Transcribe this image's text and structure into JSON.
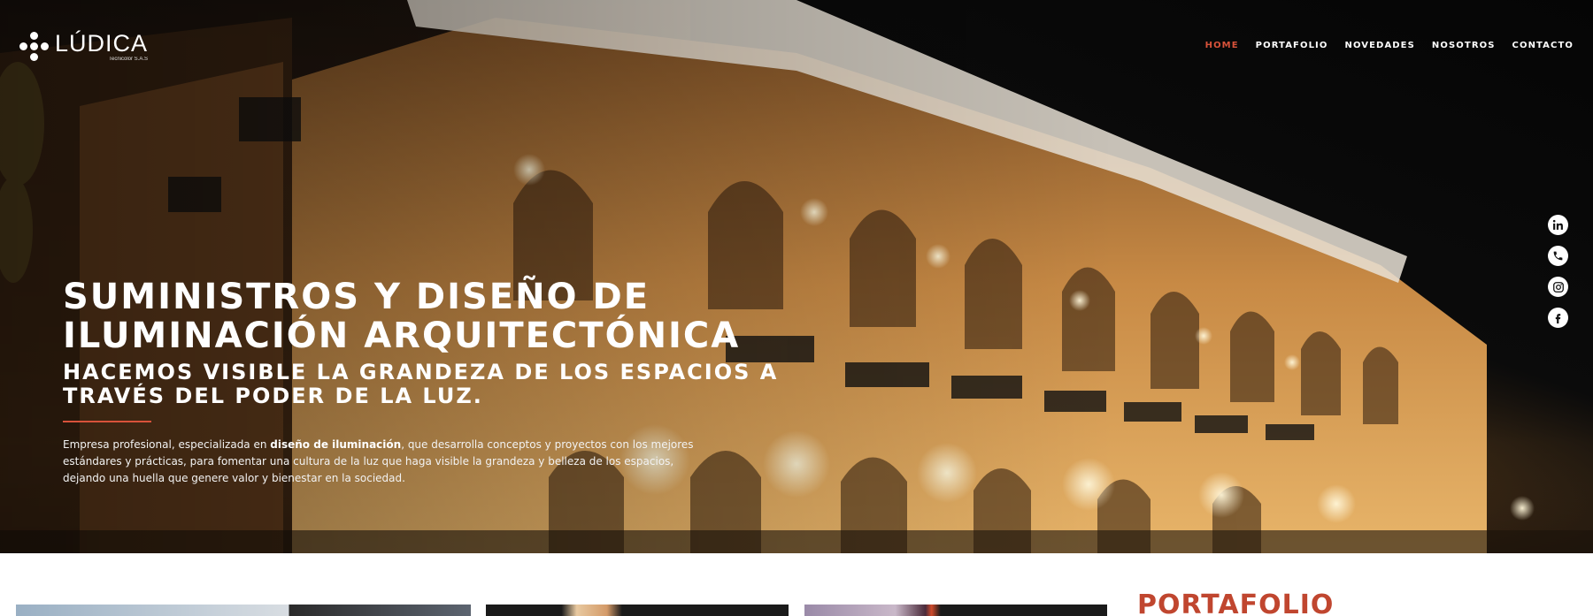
{
  "brand": {
    "name": "LÚDICA",
    "tagline": "Tecnicolor S.A.S"
  },
  "nav": {
    "items": [
      {
        "label": "HOME",
        "active": true
      },
      {
        "label": "PORTAFOLIO",
        "active": false
      },
      {
        "label": "NOVEDADES",
        "active": false
      },
      {
        "label": "NOSOTROS",
        "active": false
      },
      {
        "label": "CONTACTO",
        "active": false
      }
    ]
  },
  "hero": {
    "headline_line1": "SUMINISTROS Y DISEÑO DE",
    "headline_line2": "ILUMINACIÓN ARQUITECTÓNICA",
    "subheadline_line1": "HACEMOS VISIBLE LA GRANDEZA DE LOS ESPACIOS A",
    "subheadline_line2": "TRAVÉS DEL PODER DE LA LUZ.",
    "description_pre": "Empresa profesional, especializada en ",
    "description_bold": "diseño de iluminación",
    "description_post": ", que desarrolla conceptos y proyectos con los mejores estándares y prácticas, para fomentar una cultura de la luz que haga visible la grandeza y belleza de los espacios, dejando una huella que genere valor y bienestar en la sociedad."
  },
  "social": {
    "icons": [
      "linkedin-icon",
      "phone-icon",
      "instagram-icon",
      "facebook-icon"
    ]
  },
  "portfolio": {
    "heading": "PORTAFOLIO"
  },
  "colors": {
    "accent": "#d8523a",
    "portfolio_heading": "#c0462f",
    "text_on_dark": "#ffffff"
  }
}
